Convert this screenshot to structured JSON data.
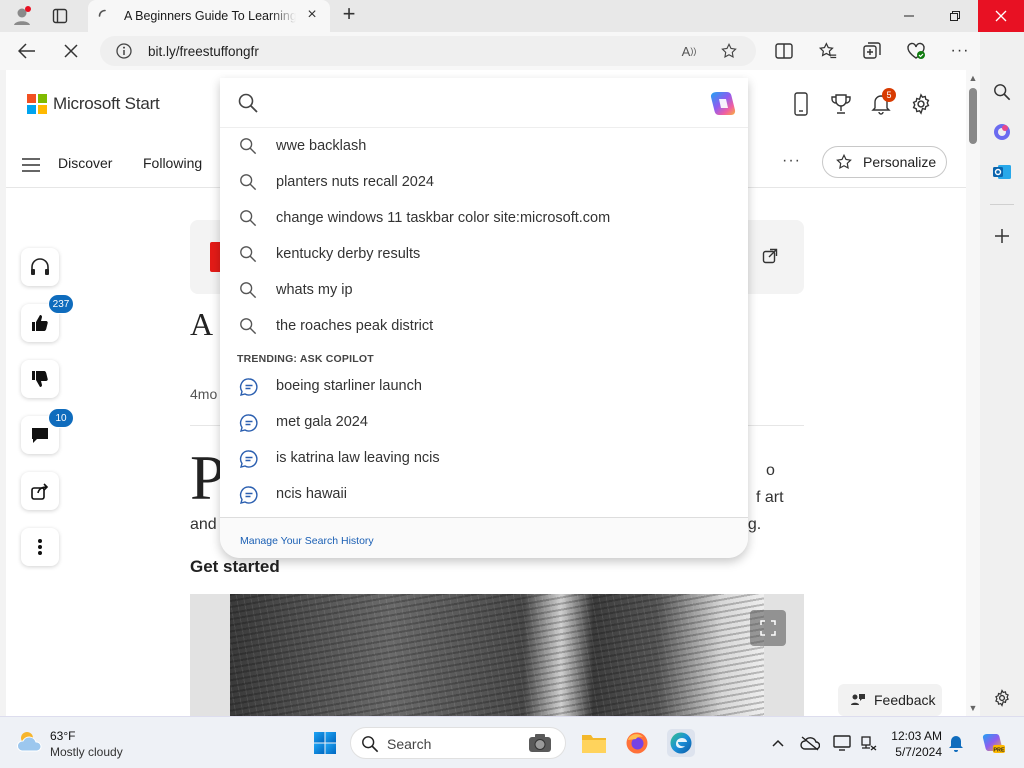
{
  "browser": {
    "tab_title": "A Beginners Guide To Learning P",
    "url": "bit.ly/freestuffongfr"
  },
  "header": {
    "brand": "Microsoft Start",
    "notification_count": "5",
    "nav": {
      "discover": "Discover",
      "following": "Following",
      "more": "···",
      "personalize": "Personalize"
    }
  },
  "article": {
    "headline_fragment": "A",
    "time_fragment": "4mo",
    "dropcap": "P",
    "body_fragments": {
      "right1": "o",
      "right2": "f art",
      "left3": "and",
      "right3": "ng."
    },
    "section_heading": "Get started",
    "feedback": "Feedback"
  },
  "actions": {
    "likes_count": "237",
    "comments_count": "10"
  },
  "search": {
    "suggestions": [
      "wwe backlash",
      "planters nuts recall 2024",
      "change windows 11 taskbar color site:microsoft.com",
      "kentucky derby results",
      "whats my ip",
      "the roaches peak district"
    ],
    "trending_label": "TRENDING: ASK COPILOT",
    "trending": [
      "boeing starliner launch",
      "met gala 2024",
      "is katrina law leaving ncis",
      "ncis hawaii"
    ],
    "manage_history": "Manage Your Search History"
  },
  "taskbar": {
    "temperature": "63°F",
    "weather": "Mostly cloudy",
    "search_label": "Search",
    "time": "12:03 AM",
    "date": "5/7/2024"
  },
  "colors": {
    "accent": "#0f6cbd",
    "close_red": "#e81123",
    "badge_orange": "#d83b01"
  }
}
